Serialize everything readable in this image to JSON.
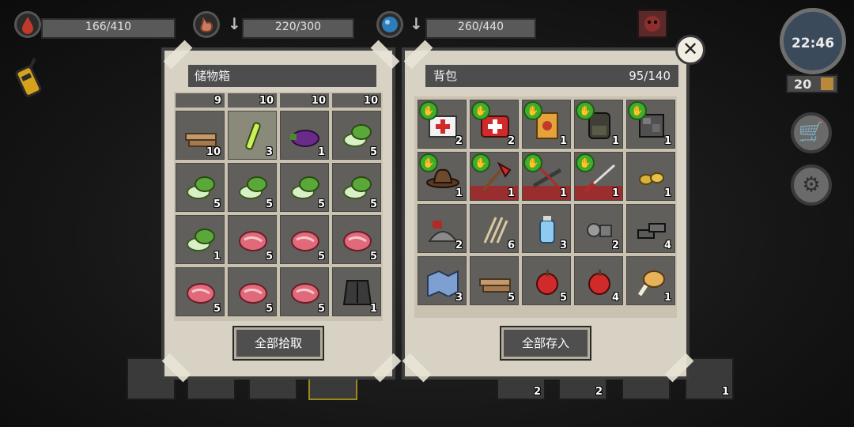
{
  "hud": {
    "health": {
      "value": "166/410",
      "icon": "blood-drop-icon",
      "color": "#c0392b"
    },
    "food": {
      "value": "220/300",
      "icon": "stomach-icon",
      "color": "#c97b5a"
    },
    "water": {
      "value": "260/440",
      "icon": "water-icon",
      "color": "#2e7db8"
    },
    "clock": {
      "time": "22:46"
    },
    "day": {
      "value": "20"
    }
  },
  "storage": {
    "title": "储物箱",
    "top_row": [
      "9",
      "10",
      "10",
      "10"
    ],
    "slots": [
      {
        "icon": "wood-planks-icon",
        "qty": "10"
      },
      {
        "icon": "glowstick-icon",
        "qty": "3",
        "highlight": true
      },
      {
        "icon": "eggplant-icon",
        "qty": "1"
      },
      {
        "icon": "bok-choy-icon",
        "qty": "5"
      },
      {
        "icon": "bok-choy-icon",
        "qty": "5"
      },
      {
        "icon": "bok-choy-icon",
        "qty": "5"
      },
      {
        "icon": "bok-choy-icon",
        "qty": "5"
      },
      {
        "icon": "bok-choy-icon",
        "qty": "5"
      },
      {
        "icon": "bok-choy-icon",
        "qty": "1"
      },
      {
        "icon": "raw-meat-icon",
        "qty": "5"
      },
      {
        "icon": "raw-meat-icon",
        "qty": "5"
      },
      {
        "icon": "raw-meat-icon",
        "qty": "5"
      },
      {
        "icon": "raw-meat-icon",
        "qty": "5"
      },
      {
        "icon": "raw-meat-icon",
        "qty": "5"
      },
      {
        "icon": "raw-meat-icon",
        "qty": "5"
      },
      {
        "icon": "armor-vest-icon",
        "qty": "1"
      }
    ],
    "button": "全部拾取"
  },
  "backpack": {
    "title": "背包",
    "capacity": "95/140",
    "slots": [
      {
        "icon": "first-aid-kit-icon",
        "qty": "2",
        "badge": true
      },
      {
        "icon": "medkit-red-icon",
        "qty": "2",
        "badge": true
      },
      {
        "icon": "snack-bag-icon",
        "qty": "1",
        "badge": true
      },
      {
        "icon": "backpack-icon",
        "qty": "1",
        "badge": true
      },
      {
        "icon": "scrap-armor-icon",
        "qty": "1",
        "badge": true
      },
      {
        "icon": "cowboy-hat-icon",
        "qty": "1",
        "badge": true
      },
      {
        "icon": "fire-axe-icon",
        "qty": "1",
        "badge": true,
        "damaged": true
      },
      {
        "icon": "crossbow-icon",
        "qty": "1",
        "badge": true,
        "damaged": true
      },
      {
        "icon": "katana-icon",
        "qty": "1",
        "badge": true,
        "damaged": true
      },
      {
        "icon": "gold-nuggets-icon",
        "qty": "1"
      },
      {
        "icon": "gunpowder-icon",
        "qty": "2"
      },
      {
        "icon": "arrows-icon",
        "qty": "6"
      },
      {
        "icon": "water-bottle-icon",
        "qty": "3"
      },
      {
        "icon": "metal-parts-icon",
        "qty": "2"
      },
      {
        "icon": "iron-ingots-icon",
        "qty": "4"
      },
      {
        "icon": "map-icon",
        "qty": "3"
      },
      {
        "icon": "wood-planks-icon",
        "qty": "5"
      },
      {
        "icon": "apple-icon",
        "qty": "5"
      },
      {
        "icon": "apple-icon",
        "qty": "4"
      },
      {
        "icon": "chicken-leg-icon",
        "qty": "1"
      }
    ],
    "button": "全部存入"
  },
  "hotbar_bg": [
    "2",
    "2",
    "1"
  ]
}
